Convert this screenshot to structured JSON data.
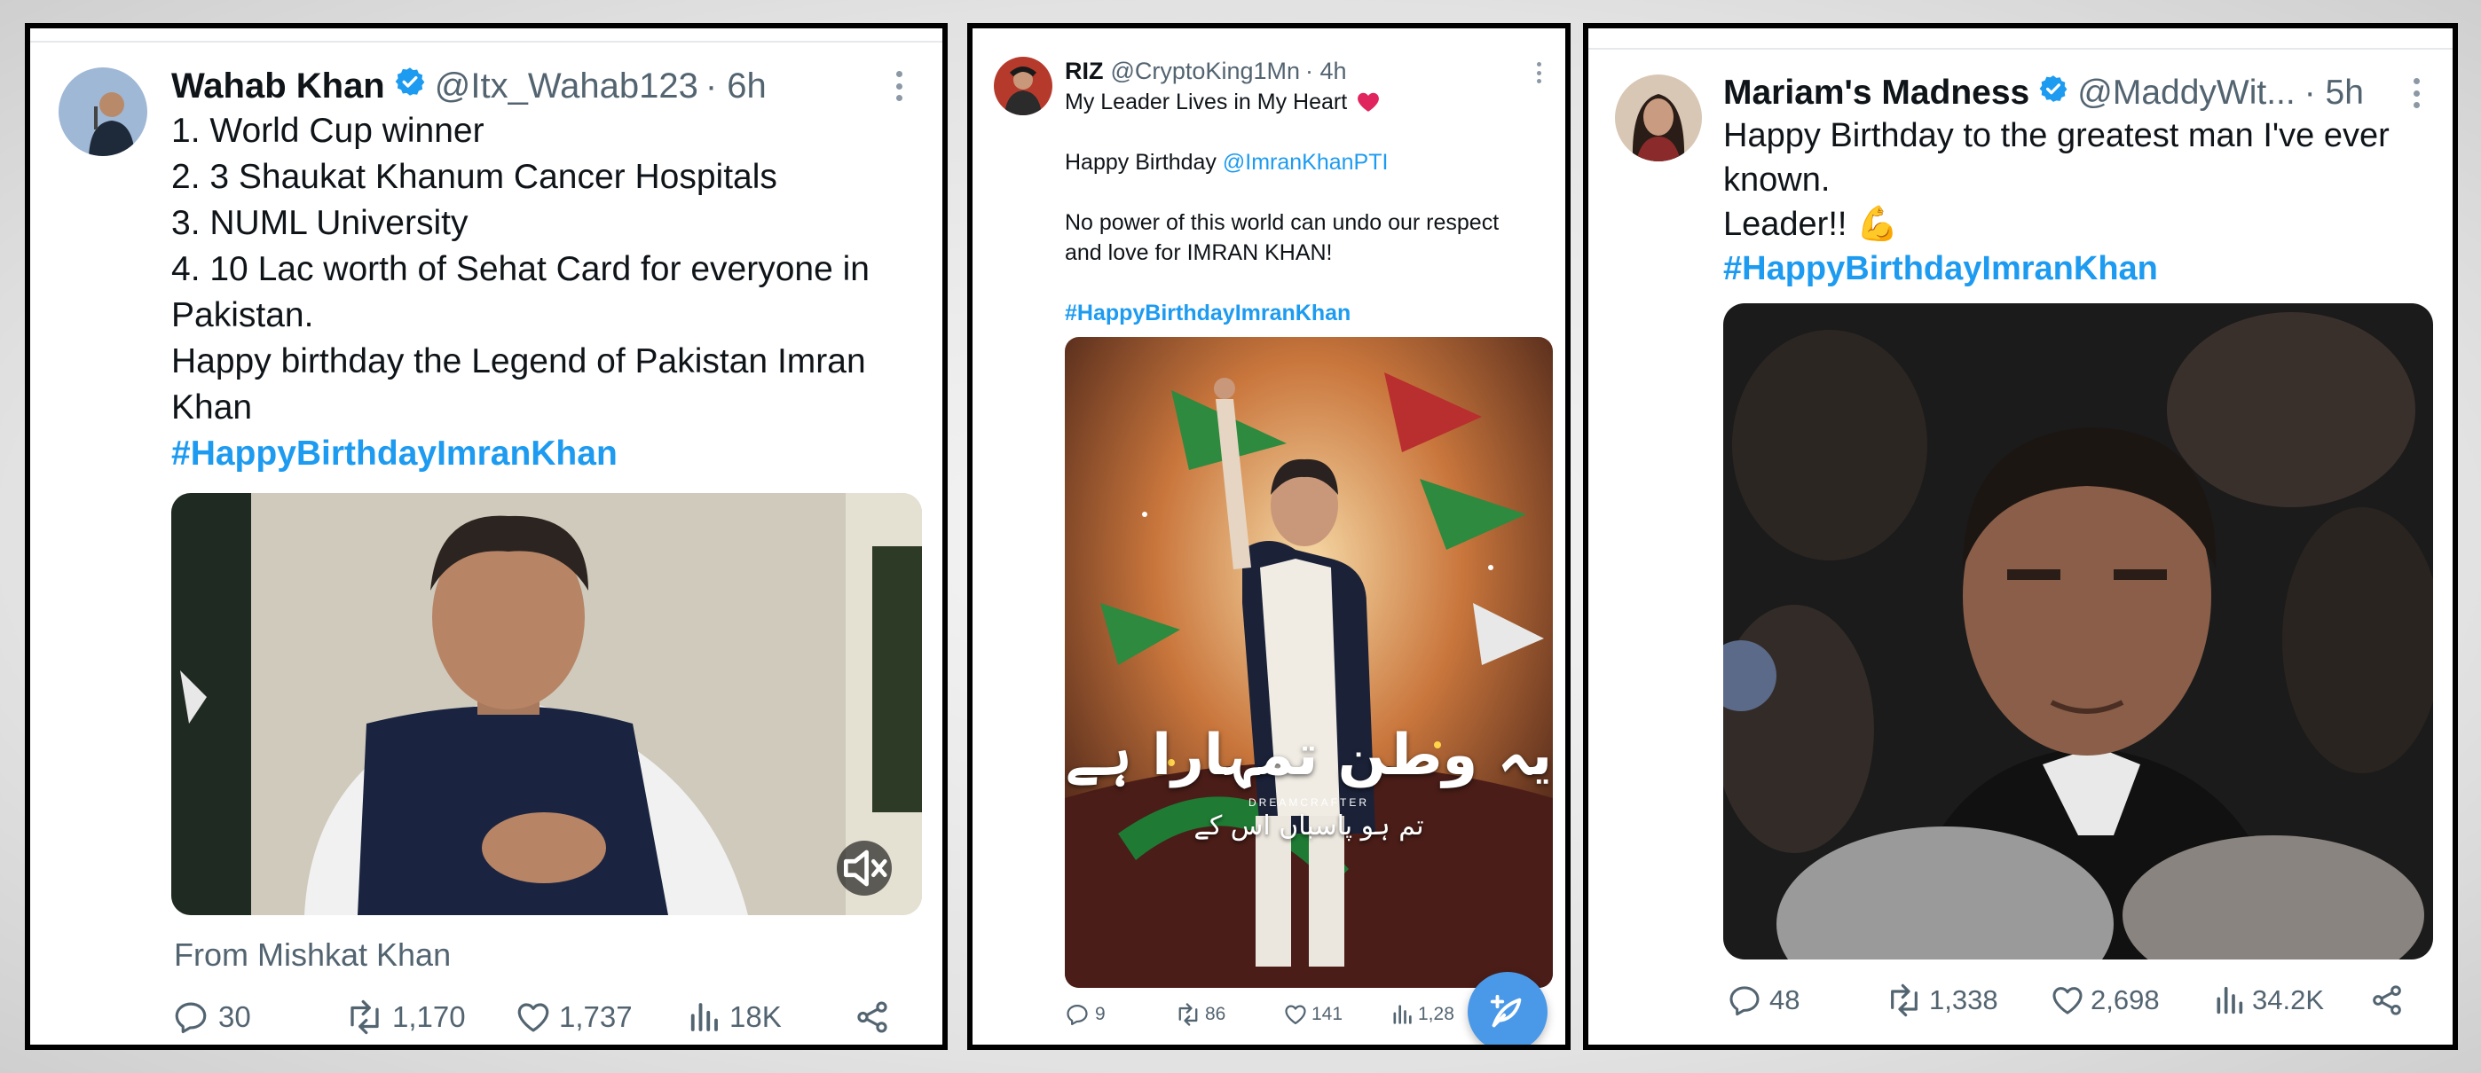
{
  "tweets": [
    {
      "display_name": "Wahab Khan",
      "handle": "@Itx_Wahab123",
      "time": "· 6h",
      "lines": [
        "1. World Cup winner",
        "2. 3 Shaukat Khanum Cancer Hospitals",
        "3. NUML University",
        "4. 10 Lac worth of Sehat Card for everyone in",
        "Pakistan.",
        "Happy birthday the Legend of Pakistan Imran",
        "Khan"
      ],
      "hashtag": "#HappyBirthdayImranKhan",
      "attribution": "From Mishkat Khan",
      "stats": {
        "replies": "30",
        "reposts": "1,170",
        "likes": "1,737",
        "views": "18K"
      }
    },
    {
      "display_name": "RIZ",
      "handle": "@CryptoKing1Mn",
      "time": "· 4h",
      "line1": "My Leader Lives in My Heart",
      "line2_prefix": "Happy Birthday ",
      "mention": "@ImranKhanPTI",
      "line3": "No power of this world can undo our respect",
      "line4": "and love for IMRAN KHAN!",
      "hashtag": "#HappyBirthdayImranKhan",
      "poster_urdu_title": "یہ وطن تمہارا ہے",
      "poster_urdu_subtitle": "تم ہو پاسباں اس کے",
      "poster_credit": "DREAMCRAFTER",
      "stats": {
        "replies": "9",
        "reposts": "86",
        "likes": "141",
        "views": "1,28"
      }
    },
    {
      "display_name": "Mariam's Madness",
      "handle": "@MaddyWit...",
      "time": "· 5h",
      "line1": "Happy Birthday to the greatest man I've ever",
      "line2": "known.",
      "line3": "Leader!! 💪",
      "hashtag": "#HappyBirthdayImranKhan",
      "stats": {
        "replies": "48",
        "reposts": "1,338",
        "likes": "2,698",
        "views": "34.2K"
      }
    }
  ],
  "colors": {
    "link": "#1d9bf0",
    "verified": "#1d9bf0",
    "muted": "#536471",
    "fab": "#4a99e9"
  }
}
